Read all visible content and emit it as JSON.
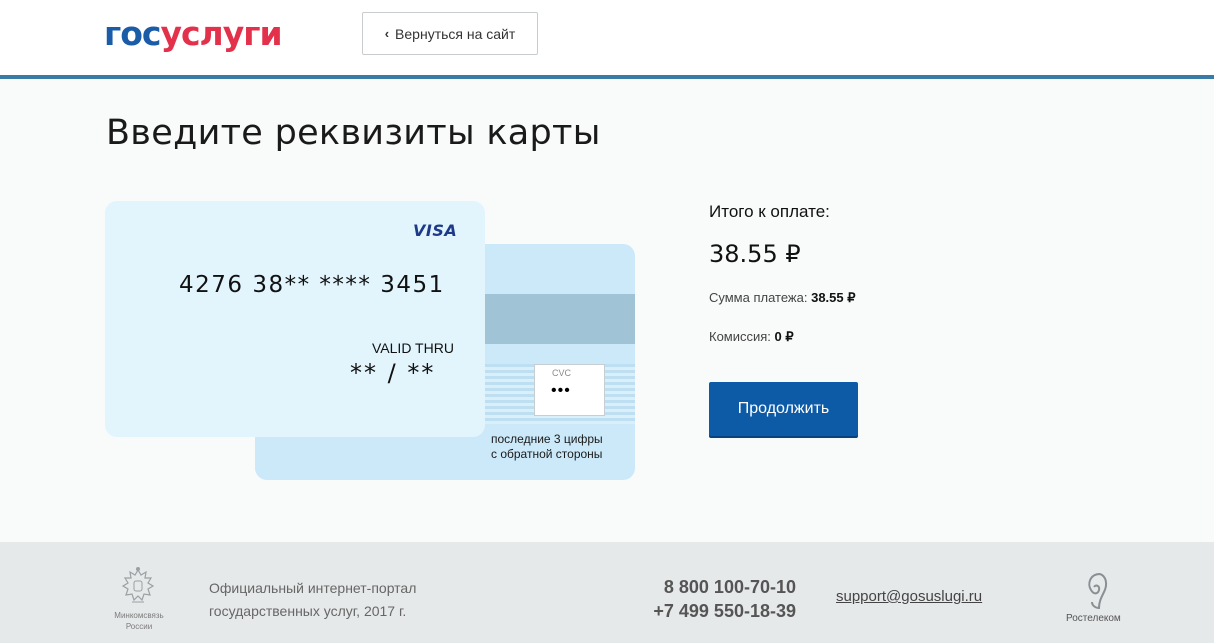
{
  "header": {
    "logo_part1": "гос",
    "logo_part2": "услуги",
    "back_label": "Вернуться на сайт",
    "back_icon": "chevron-left-icon",
    "accent_color": "#3a7aa6"
  },
  "page": {
    "title": "Введите реквизиты карты"
  },
  "card_front": {
    "brand": "VISA",
    "number": "4276 38** **** 3451",
    "valid_label": "VALID THRU",
    "valid_value": "** / **",
    "color": "#e2f5fd"
  },
  "card_back": {
    "cvc_label": "CVC",
    "cvc_value": "•••",
    "hint_line1": "последние 3 цифры",
    "hint_line2": "с обратной стороны",
    "color": "#cbe9f9"
  },
  "payment": {
    "total_label": "Итого к оплате:",
    "total_value": "38.55 ₽",
    "sum_label": "Сумма платежа:",
    "sum_value": "38.55 ₽",
    "fee_label": "Комиссия:",
    "fee_value": "0 ₽",
    "continue_label": "Продолжить",
    "button_color": "#0d5aa7"
  },
  "footer": {
    "ministry_line1": "Минкомсвязь",
    "ministry_line2": "России",
    "portal_line1": "Официальный интернет-портал",
    "portal_line2": "государственных услуг, 2017 г.",
    "phone1": "8 800 100-70-10",
    "phone2": "+7 499 550-18-39",
    "email": "support@gosuslugi.ru",
    "partner": "Ростелеком",
    "emblem_icon": "coat-of-arms-icon",
    "partner_icon": "rostelecom-logo-icon"
  }
}
